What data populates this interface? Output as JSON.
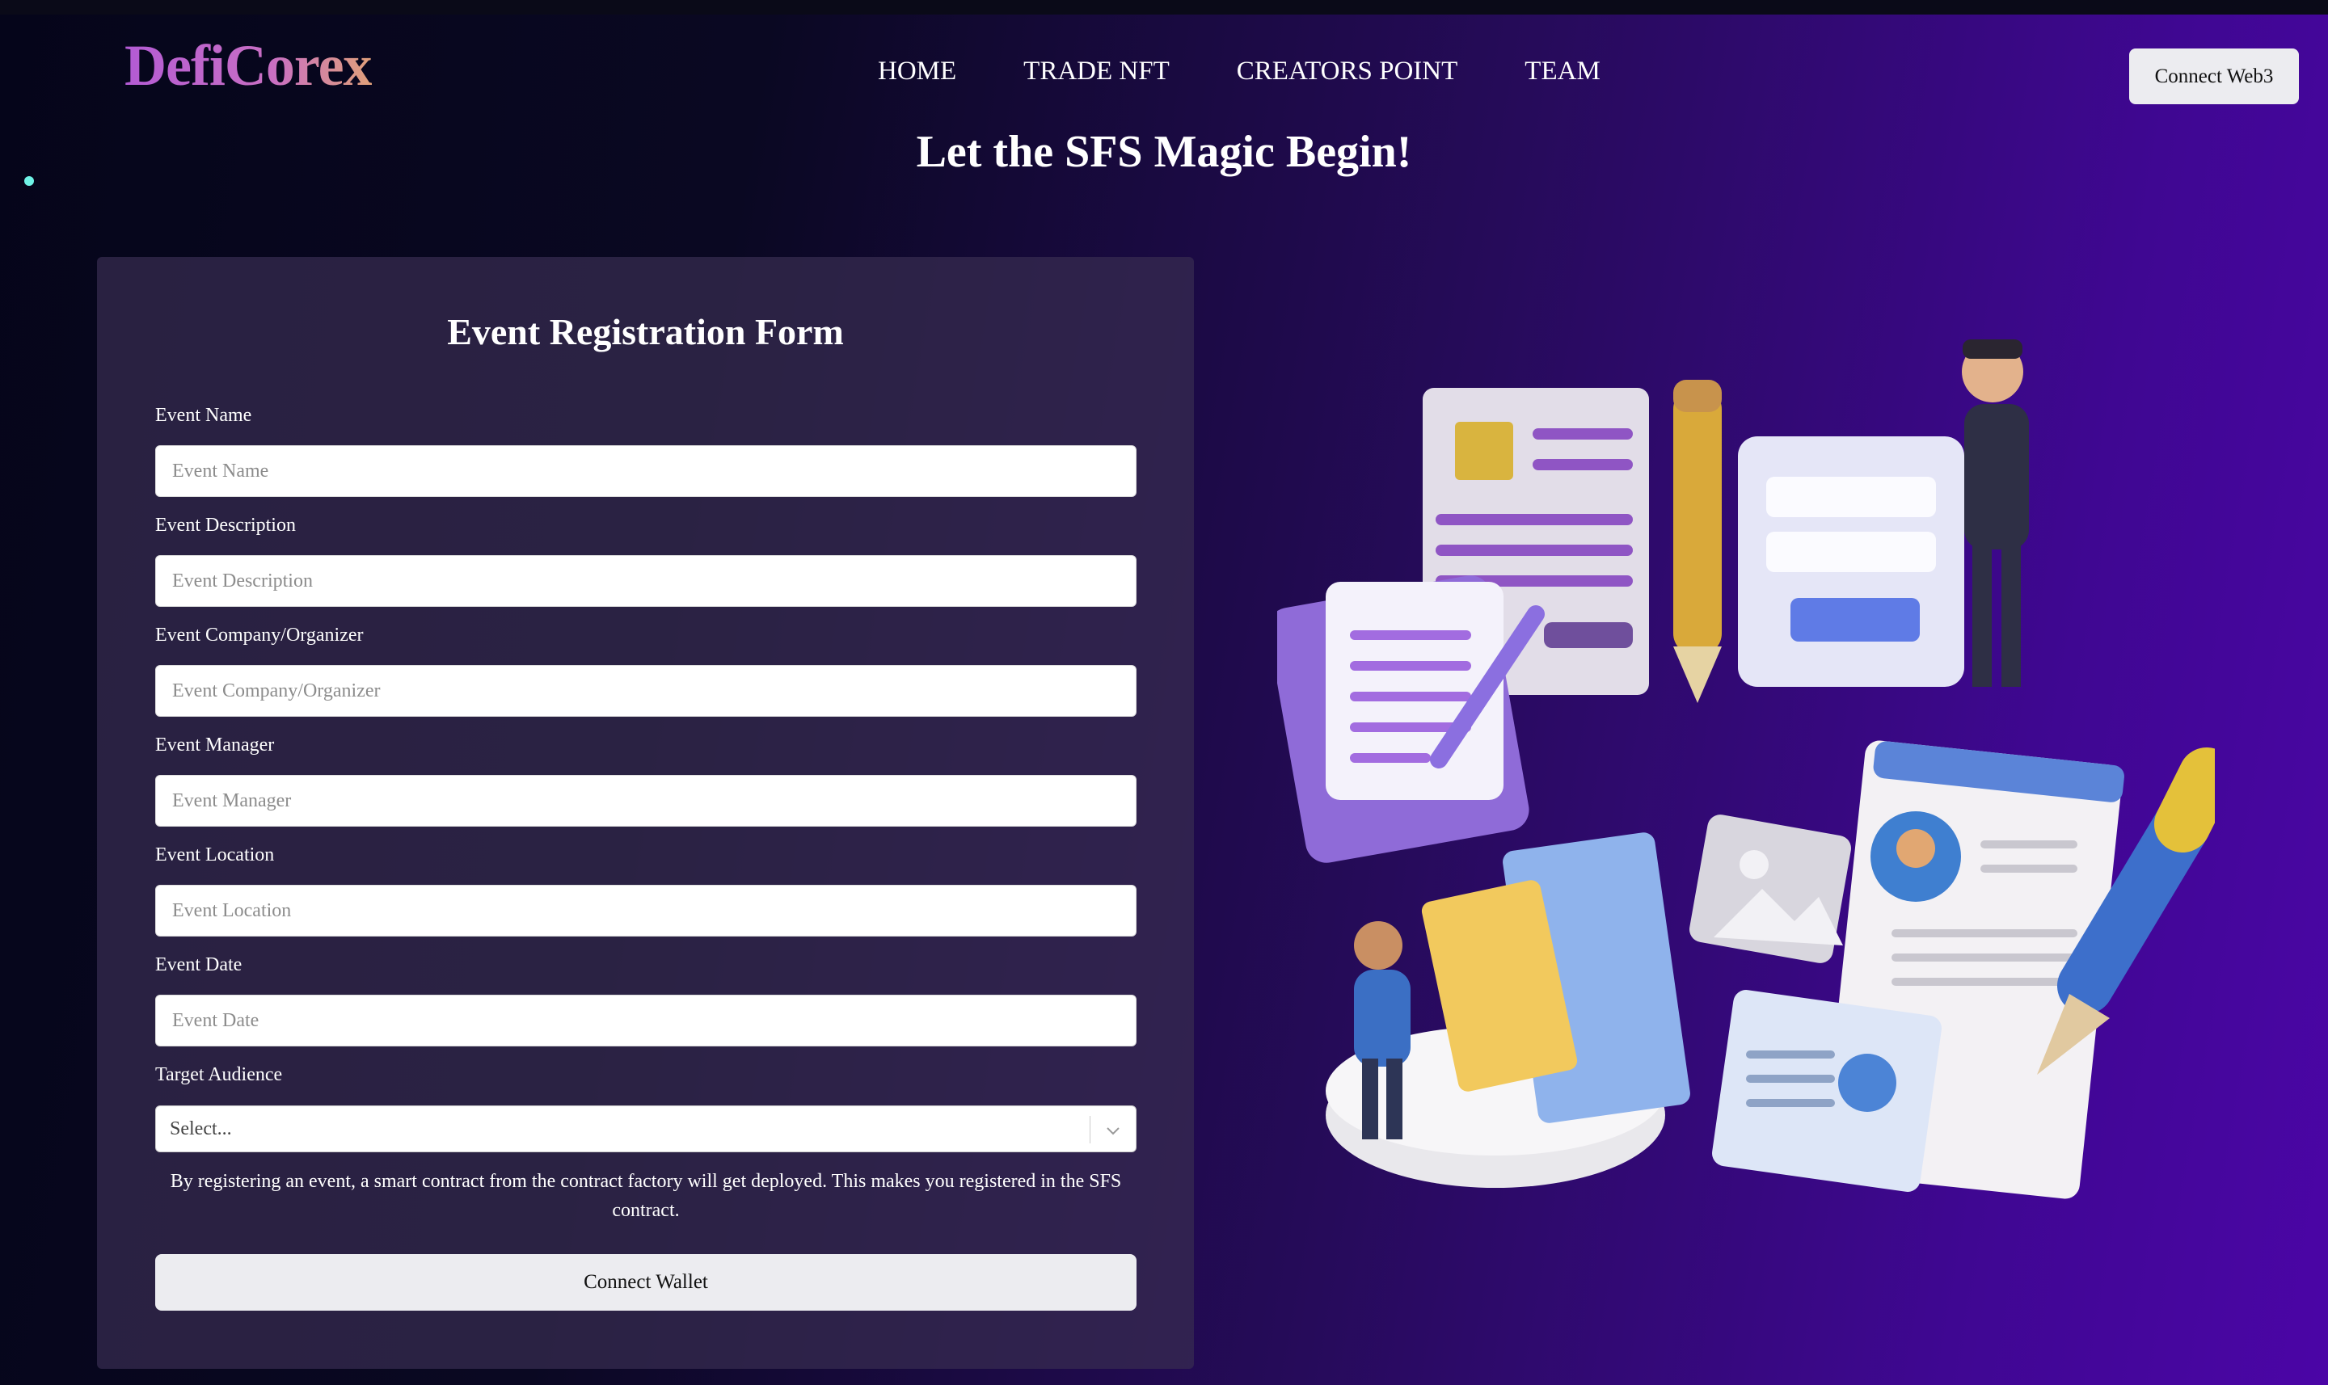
{
  "brand": {
    "logo": "DefiCorex"
  },
  "nav": {
    "items": [
      "HOME",
      "TRADE NFT",
      "CREATORS POINT",
      "TEAM"
    ]
  },
  "header": {
    "connect_web3_label": "Connect Web3"
  },
  "hero": {
    "title": "Let the SFS Magic Begin!"
  },
  "form": {
    "title": "Event Registration Form",
    "fields": [
      {
        "label": "Event Name",
        "placeholder": "Event Name",
        "value": ""
      },
      {
        "label": "Event Description",
        "placeholder": "Event Description",
        "value": ""
      },
      {
        "label": "Event Company/Organizer",
        "placeholder": "Event Company/Organizer",
        "value": ""
      },
      {
        "label": "Event Manager",
        "placeholder": "Event Manager",
        "value": ""
      },
      {
        "label": "Event Location",
        "placeholder": "Event Location",
        "value": ""
      },
      {
        "label": "Event Date",
        "placeholder": "Event Date",
        "value": ""
      }
    ],
    "audience": {
      "label": "Target Audience",
      "selected": "Select..."
    },
    "disclaimer": "By registering an event, a smart contract from the contract factory will get deployed. This makes you registered in the SFS contract.",
    "submit_label": "Connect Wallet"
  },
  "colors": {
    "accent_dot": "#6ff3e6",
    "logo_start": "#b35bd4",
    "logo_end": "#e0a07a",
    "button_bg": "#ececf0",
    "card_bg": "#372d50"
  },
  "icons": [
    "chevron-down-icon",
    "registration-illustration"
  ]
}
